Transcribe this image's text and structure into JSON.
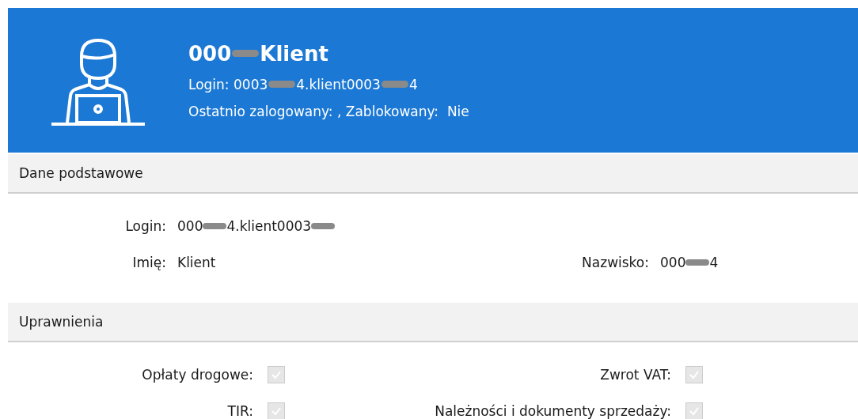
{
  "header": {
    "title": [
      {
        "kind": "text",
        "text": "000"
      },
      {
        "kind": "redaction"
      },
      {
        "kind": "text",
        "text": " Klient"
      }
    ],
    "login": [
      {
        "kind": "text",
        "text": "Login: 0003"
      },
      {
        "kind": "redaction"
      },
      {
        "kind": "text",
        "text": "4.klient0003"
      },
      {
        "kind": "redaction"
      },
      {
        "kind": "text",
        "text": "4"
      }
    ],
    "status": "Ostatnio zalogowany: , Zablokowany:  Nie"
  },
  "sections": [
    {
      "title": "Dane podstawowe",
      "kind": "fields",
      "rows": [
        [
          {
            "label": "Login:",
            "value": [
              {
                "kind": "text",
                "text": "000"
              },
              {
                "kind": "redaction"
              },
              {
                "kind": "text",
                "text": "4.klient0003"
              },
              {
                "kind": "redaction"
              }
            ]
          }
        ],
        [
          {
            "label": "Imię:",
            "value": [
              {
                "kind": "text",
                "text": "Klient"
              }
            ]
          },
          {
            "label": "Nazwisko:",
            "value": [
              {
                "kind": "text",
                "text": "000"
              },
              {
                "kind": "redaction"
              },
              {
                "kind": "text",
                "text": "4"
              }
            ]
          }
        ]
      ]
    },
    {
      "title": "Uprawnienia",
      "kind": "checks",
      "rows": [
        [
          {
            "label": "Opłaty drogowe:",
            "checked": true
          },
          {
            "label": "Zwrot VAT:",
            "checked": true
          }
        ],
        [
          {
            "label": "TIR:",
            "checked": true
          },
          {
            "label": "Należności i dokumenty sprzedaży:",
            "checked": true
          }
        ]
      ]
    }
  ]
}
